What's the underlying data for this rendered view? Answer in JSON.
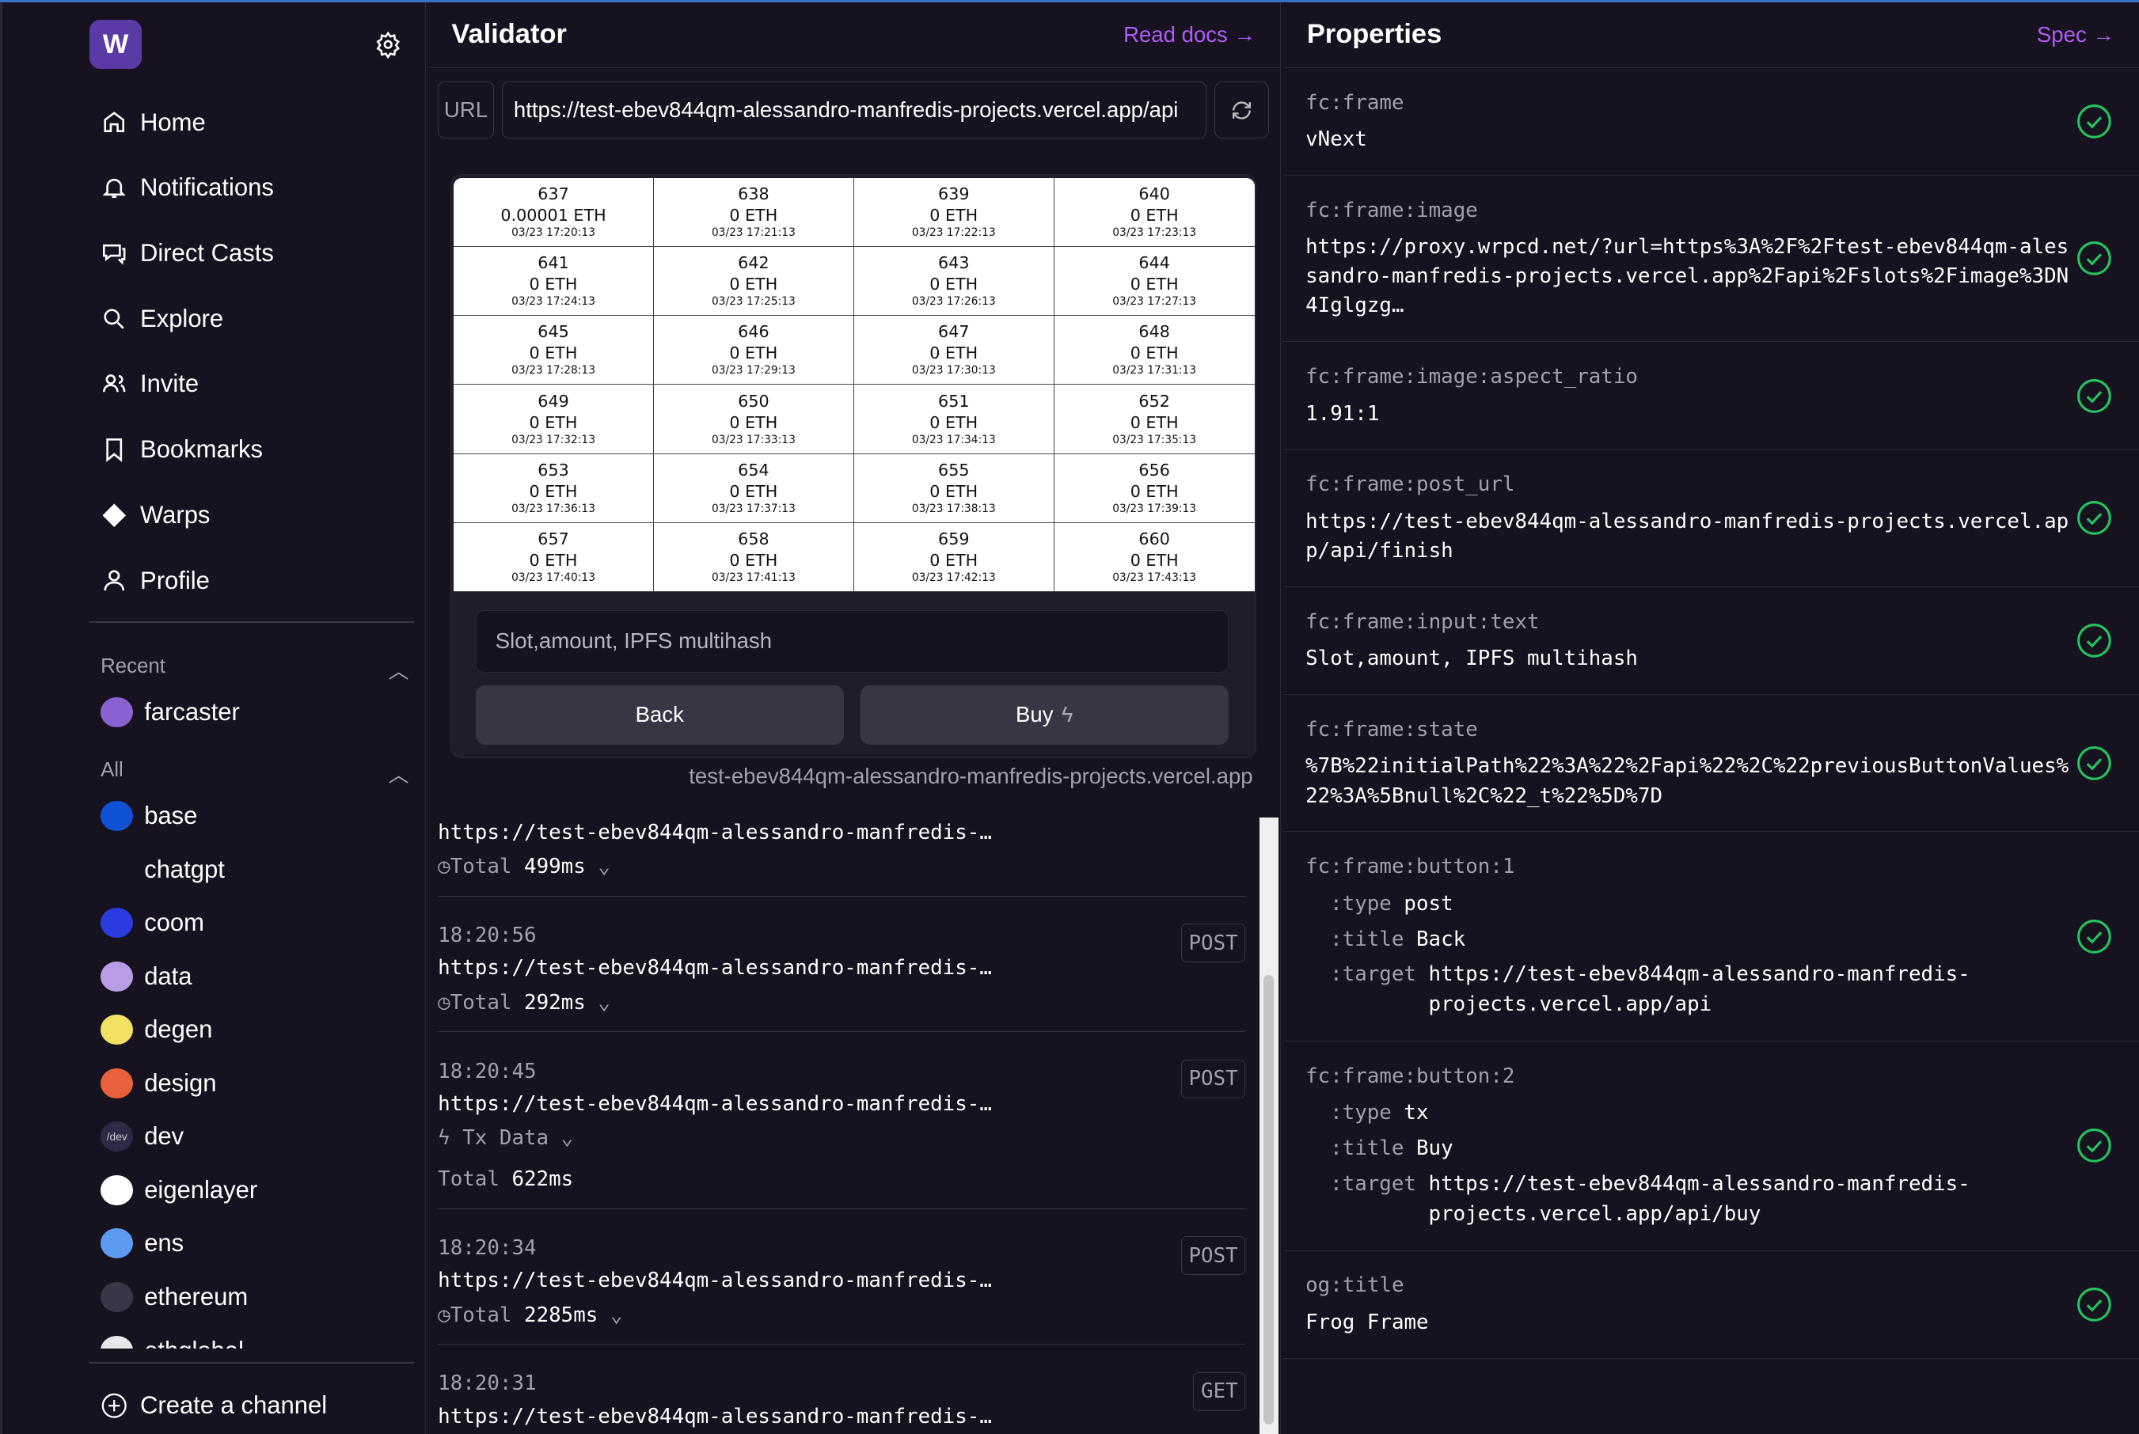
{
  "sidebar": {
    "logo": "W",
    "nav": [
      {
        "label": "Home",
        "icon": "home"
      },
      {
        "label": "Notifications",
        "icon": "bell"
      },
      {
        "label": "Direct Casts",
        "icon": "chat"
      },
      {
        "label": "Explore",
        "icon": "search"
      },
      {
        "label": "Invite",
        "icon": "users"
      },
      {
        "label": "Bookmarks",
        "icon": "bookmark"
      },
      {
        "label": "Warps",
        "icon": "diamond"
      },
      {
        "label": "Profile",
        "icon": "user"
      }
    ],
    "recent_label": "Recent",
    "all_label": "All",
    "recent": [
      {
        "name": "farcaster",
        "color": "#8a63d2"
      }
    ],
    "all": [
      {
        "name": "base",
        "color": "#1052d6"
      },
      {
        "name": "chatgpt",
        "color": "#16121f"
      },
      {
        "name": "coom",
        "color": "#2a3be0"
      },
      {
        "name": "data",
        "color": "#b89de6"
      },
      {
        "name": "degen",
        "color": "#f2e063"
      },
      {
        "name": "design",
        "color": "#e8603c"
      },
      {
        "name": "dev",
        "color": "#2f2947",
        "badge": "/dev"
      },
      {
        "name": "eigenlayer",
        "color": "#ffffff"
      },
      {
        "name": "ens",
        "color": "#5b9cf2"
      },
      {
        "name": "ethereum",
        "color": "#3b3548"
      },
      {
        "name": "ethglobal",
        "color": "#e8e8e8"
      }
    ],
    "create_channel": "Create a channel"
  },
  "validator": {
    "title": "Validator",
    "read_docs": "Read docs →",
    "url_label": "URL",
    "url": "https://test-ebev844qm-alessandro-manfredis-projects.vercel.app/api",
    "frame": {
      "cells": [
        [
          "637",
          "0.00001 ETH",
          "03/23 17:20:13"
        ],
        [
          "638",
          "0 ETH",
          "03/23 17:21:13"
        ],
        [
          "639",
          "0 ETH",
          "03/23 17:22:13"
        ],
        [
          "640",
          "0 ETH",
          "03/23 17:23:13"
        ],
        [
          "641",
          "0 ETH",
          "03/23 17:24:13"
        ],
        [
          "642",
          "0 ETH",
          "03/23 17:25:13"
        ],
        [
          "643",
          "0 ETH",
          "03/23 17:26:13"
        ],
        [
          "644",
          "0 ETH",
          "03/23 17:27:13"
        ],
        [
          "645",
          "0 ETH",
          "03/23 17:28:13"
        ],
        [
          "646",
          "0 ETH",
          "03/23 17:29:13"
        ],
        [
          "647",
          "0 ETH",
          "03/23 17:30:13"
        ],
        [
          "648",
          "0 ETH",
          "03/23 17:31:13"
        ],
        [
          "649",
          "0 ETH",
          "03/23 17:32:13"
        ],
        [
          "650",
          "0 ETH",
          "03/23 17:33:13"
        ],
        [
          "651",
          "0 ETH",
          "03/23 17:34:13"
        ],
        [
          "652",
          "0 ETH",
          "03/23 17:35:13"
        ],
        [
          "653",
          "0 ETH",
          "03/23 17:36:13"
        ],
        [
          "654",
          "0 ETH",
          "03/23 17:37:13"
        ],
        [
          "655",
          "0 ETH",
          "03/23 17:38:13"
        ],
        [
          "656",
          "0 ETH",
          "03/23 17:39:13"
        ],
        [
          "657",
          "0 ETH",
          "03/23 17:40:13"
        ],
        [
          "658",
          "0 ETH",
          "03/23 17:41:13"
        ],
        [
          "659",
          "0 ETH",
          "03/23 17:42:13"
        ],
        [
          "660",
          "0 ETH",
          "03/23 17:43:13"
        ]
      ],
      "input_placeholder": "Slot,amount, IPFS multihash",
      "back": "Back",
      "buy": "Buy",
      "domain": "test-ebev844qm-alessandro-manfredis-projects.vercel.app"
    },
    "logs": [
      {
        "time": "",
        "url": "https://test-ebev844qm-alessandro-manfredis-…",
        "method": "",
        "total_label": "Total",
        "total": "499ms",
        "clock": true
      },
      {
        "time": "18:20:56",
        "url": "https://test-ebev844qm-alessandro-manfredis-…",
        "method": "POST",
        "total_label": "Total",
        "total": "292ms",
        "clock": true
      },
      {
        "time": "18:20:45",
        "url": "https://test-ebev844qm-alessandro-manfredis-…",
        "method": "POST",
        "tx": "Tx Data",
        "total_label": "Total",
        "total": "622ms"
      },
      {
        "time": "18:20:34",
        "url": "https://test-ebev844qm-alessandro-manfredis-…",
        "method": "POST",
        "total_label": "Total",
        "total": "2285ms",
        "clock": true
      },
      {
        "time": "18:20:31",
        "url": "https://test-ebev844qm-alessandro-manfredis-…",
        "method": "GET"
      }
    ]
  },
  "properties": {
    "title": "Properties",
    "spec": "Spec →",
    "status_color": "#22c55e",
    "items": [
      {
        "key": "fc:frame",
        "value": "vNext"
      },
      {
        "key": "fc:frame:image",
        "value": "https://proxy.wrpcd.net/?url=https%3A%2F%2Ftest-ebev844qm-alessandro-manfredis-projects.vercel.app%2Fapi%2Fslots%2Fimage%3DN4Iglgzg…"
      },
      {
        "key": "fc:frame:image:aspect_ratio",
        "value": "1.91:1"
      },
      {
        "key": "fc:frame:post_url",
        "value": "https://test-ebev844qm-alessandro-manfredis-projects.vercel.app/api/finish"
      },
      {
        "key": "fc:frame:input:text",
        "value": "Slot,amount, IPFS multihash"
      },
      {
        "key": "fc:frame:state",
        "value": "%7B%22initialPath%22%3A%22%2Fapi%22%2C%22previousButtonValues%22%3A%5Bnull%2C%22_t%22%5D%7D"
      },
      {
        "key": "fc:frame:button:1",
        "sub": [
          [
            ":type",
            "post"
          ],
          [
            ":title",
            "Back"
          ],
          [
            ":target",
            "https://test-ebev844qm-alessandro-manfredis-projects.vercel.app/api"
          ]
        ]
      },
      {
        "key": "fc:frame:button:2",
        "sub": [
          [
            ":type",
            "tx"
          ],
          [
            ":title",
            "Buy"
          ],
          [
            ":target",
            "https://test-ebev844qm-alessandro-manfredis-projects.vercel.app/api/buy"
          ]
        ]
      },
      {
        "key": "og:title",
        "value": "Frog Frame"
      }
    ]
  }
}
